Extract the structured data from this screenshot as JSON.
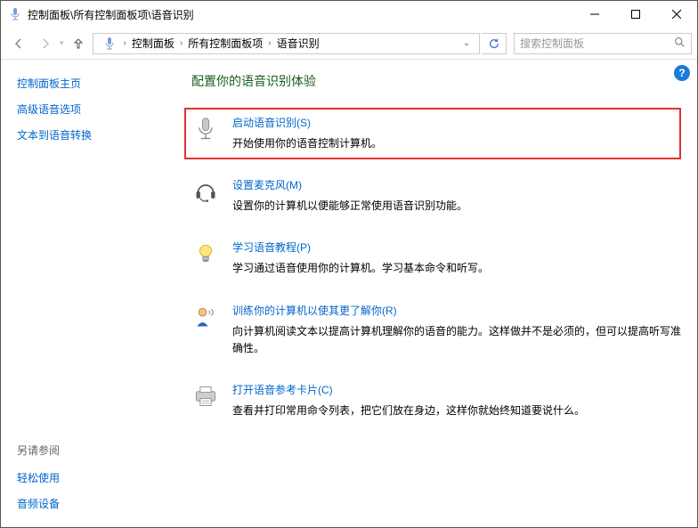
{
  "window_title": "控制面板\\所有控制面板项\\语音识别",
  "breadcrumb": [
    "控制面板",
    "所有控制面板项",
    "语音识别"
  ],
  "search_placeholder": "搜索控制面板",
  "sidebar": {
    "home": "控制面板主页",
    "adv": "高级语音选项",
    "tts": "文本到语音转换",
    "see_also": "另请参阅",
    "ease": "轻松使用",
    "audio": "音频设备"
  },
  "main": {
    "heading": "配置你的语音识别体验",
    "opts": [
      {
        "title": "启动语音识别(S)",
        "desc": "开始使用你的语音控制计算机。"
      },
      {
        "title": "设置麦克风(M)",
        "desc": "设置你的计算机以便能够正常使用语音识别功能。"
      },
      {
        "title": "学习语音教程(P)",
        "desc": "学习通过语音使用你的计算机。学习基本命令和听写。"
      },
      {
        "title": "训练你的计算机以使其更了解你(R)",
        "desc": "向计算机阅读文本以提高计算机理解你的语音的能力。这样做并不是必须的，但可以提高听写准确性。"
      },
      {
        "title": "打开语音参考卡片(C)",
        "desc": "查看并打印常用命令列表，把它们放在身边，这样你就始终知道要说什么。"
      }
    ]
  }
}
